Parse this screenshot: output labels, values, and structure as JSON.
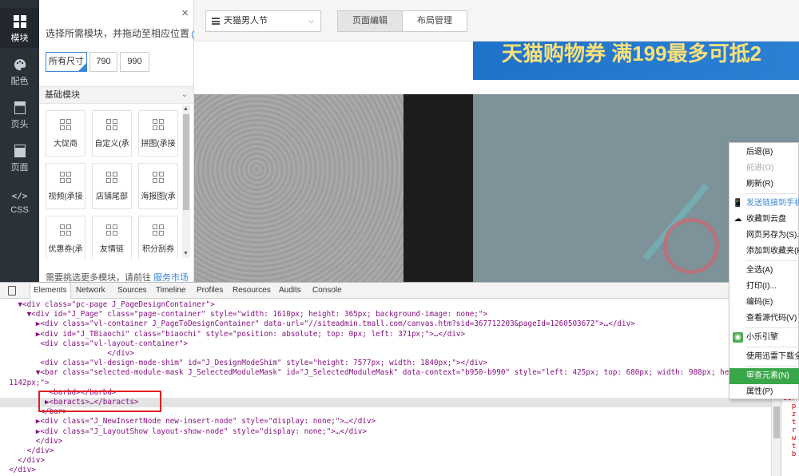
{
  "nav": {
    "items": [
      {
        "label": "模块",
        "icon": "grid-icon"
      },
      {
        "label": "配色",
        "icon": "palette-icon"
      },
      {
        "label": "页头",
        "icon": "page-header-icon"
      },
      {
        "label": "页面",
        "icon": "page-icon"
      },
      {
        "label": "CSS",
        "icon": "code-icon"
      }
    ]
  },
  "panel": {
    "close": "×",
    "hint": "选择所需模块，并拖动至相应位置",
    "help": "?",
    "sizes": [
      "所有尺寸",
      "790",
      "990"
    ],
    "section_title": "基础模块",
    "tiles": [
      "大促商",
      "自定义(承",
      "拼图(承接",
      "视频(承接",
      "店铺尾部",
      "海报图(承",
      "优惠券(承",
      "友情链",
      "积分刮券"
    ],
    "footer_text": "需要挑选更多模块，请前往",
    "footer_link": "服务市场"
  },
  "toolbar": {
    "page_select": "天猫男人节",
    "tabs": [
      "页面编辑",
      "布局管理"
    ]
  },
  "canvas": {
    "banner_text": "天猫购物券  满199最多可抵2"
  },
  "devtools": {
    "tabs": [
      "Elements",
      "Network",
      "Sources",
      "Timeline",
      "Profiles",
      "Resources",
      "Audits",
      "Console"
    ],
    "dom_lines": [
      "    ▼<div class=\"pc-page J_PageDesignContainer\">",
      "      ▼<div id=\"J_Page\" class=\"page-container\" style=\"width: 1610px; height: 365px; background-image: none;\">",
      "        ▶<div class=\"vl-container J_PageToDesignContainer\" data-url=\"//siteadmin.tmall.com/canvas.htm?sid=367712203&pageId=1260503672\">…</div>",
      "        ▶<div id=\"J_TBiaochi\" class=\"biaochi\" style=\"position: absolute; top: 0px; left: 371px;\">…</div>",
      "         <div class=\"vl-layout-container\">",
      "                        </div>",
      "         <div class=\"vl-design-mode-shim\" id=\"J_DesignModeShim\" style=\"height: 7577px; width: 1840px;\"></div>",
      "        ▼<bar class=\"selected-module-mask J_SelectedModuleMask\" id=\"J_SelectedModuleMask\" data-context=\"b950-b990\" style=\"left: 425px; top: 680px; width: 988px; height:",
      "  1142px;\">",
      "           <barbd></barbd>",
      "          ▶<baracts>…</baracts>",
      "         </bar>",
      "        ▶<div class=\"J_NewInsertNode new-insert-node\" style=\"display: none;\">…</div>",
      "        ▶<div class=\"J_LayoutShow layout-show-node\" style=\"display: none;\">…</div>",
      "        </div>",
      "      </div>",
      "    </div>",
      "  </div>"
    ],
    "styles_snippet": "bar\n  p\n  z\n  t\n  r\n  w\n  t\n  b"
  },
  "context_menu": {
    "items": [
      {
        "label": "后退(B)",
        "state": "normal",
        "icon": ""
      },
      {
        "label": "前进(O)",
        "state": "disabled",
        "icon": ""
      },
      {
        "label": "刷新(R)",
        "state": "normal",
        "icon": ""
      },
      {
        "label": "发送链接到手机",
        "state": "link",
        "icon": "phone-icon"
      },
      {
        "label": "收藏到云盘",
        "state": "normal",
        "icon": "cloud-icon"
      },
      {
        "label": "网页另存为(S)...",
        "state": "normal",
        "icon": ""
      },
      {
        "label": "添加到收藏夹(F)",
        "state": "normal",
        "icon": ""
      },
      {
        "label": "全选(A)",
        "state": "normal",
        "icon": ""
      },
      {
        "label": "打印(I)...",
        "state": "normal",
        "icon": ""
      },
      {
        "label": "编码(E)",
        "state": "normal",
        "icon": ""
      },
      {
        "label": "查看源代码(V)",
        "state": "normal",
        "icon": ""
      },
      {
        "label": "小乐引擎",
        "state": "normal",
        "icon": "xiaole-icon"
      },
      {
        "label": "使用迅雷下载全",
        "state": "normal",
        "icon": ""
      },
      {
        "label": "审查元素(N)",
        "state": "selected",
        "icon": ""
      },
      {
        "label": "属性(P)",
        "state": "normal",
        "icon": ""
      }
    ]
  },
  "colors": {
    "accent": "#3a86d8",
    "menu_selected": "#3aa64a",
    "highlight": "#e02020",
    "nav_bg": "#2b3139"
  }
}
